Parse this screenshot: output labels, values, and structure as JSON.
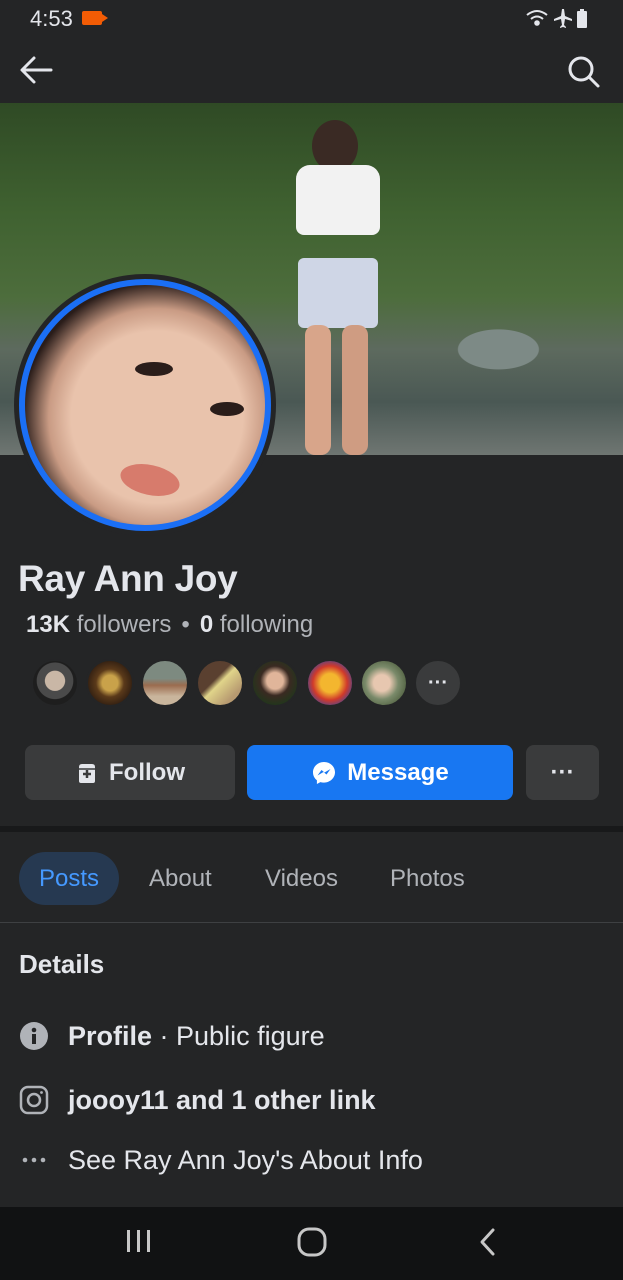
{
  "status_bar": {
    "time": "4:53",
    "icons": [
      "record-icon",
      "wifi-icon",
      "airplane-icon",
      "battery-icon"
    ]
  },
  "nav": {
    "back_icon": "arrow-left-icon",
    "search_icon": "search-icon"
  },
  "profile": {
    "name": "Ray Ann Joy",
    "followers_count": "13K",
    "followers_label": "followers",
    "separator": "•",
    "following_count": "0",
    "following_label": "following",
    "mutual_more": "···"
  },
  "actions": {
    "follow_label": "Follow",
    "message_label": "Message",
    "more_label": "···"
  },
  "tabs": [
    {
      "label": "Posts",
      "active": true
    },
    {
      "label": "About",
      "active": false
    },
    {
      "label": "Videos",
      "active": false
    },
    {
      "label": "Photos",
      "active": false
    }
  ],
  "details": {
    "title": "Details",
    "profile_bold": "Profile",
    "profile_rest": " · Public figure",
    "links_text": "joooy11 and 1 other link",
    "about_text": "See Ray Ann Joy's About Info"
  },
  "colors": {
    "background": "#242526",
    "accent": "#1877f2",
    "active_tab_bg": "#263951",
    "active_tab_text": "#4599ff"
  }
}
